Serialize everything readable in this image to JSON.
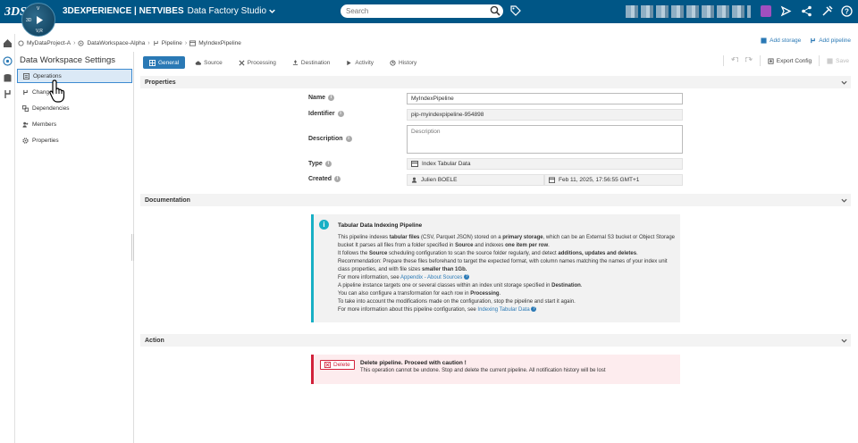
{
  "app": {
    "brand_bold": "3DEXPERIENCE | NETVIBES",
    "app_name": "Data Factory Studio",
    "logo_text": "3DS",
    "compass_labels": {
      "top": "V",
      "left": "3D",
      "bottom": "V,R"
    }
  },
  "search": {
    "placeholder": "Search"
  },
  "breadcrumb": {
    "project": "MyDataProject-A",
    "workspace": "DataWorkspace-Alpha",
    "type": "Pipeline",
    "item": "MyIndexPipeline"
  },
  "top_actions": {
    "add_storage": "Add storage",
    "add_pipeline": "Add pipeline"
  },
  "settings": {
    "title": "Data Workspace Settings",
    "items": [
      {
        "label": "Operations",
        "icon": "list-icon",
        "active": true
      },
      {
        "label": "Changes",
        "icon": "branch-icon"
      },
      {
        "label": "Dependencies",
        "icon": "link-icon"
      },
      {
        "label": "Members",
        "icon": "users-icon"
      },
      {
        "label": "Properties",
        "icon": "gear-icon"
      }
    ]
  },
  "tabs": [
    {
      "label": "General",
      "icon": "grid-icon",
      "active": true
    },
    {
      "label": "Source",
      "icon": "cloud-icon"
    },
    {
      "label": "Processing",
      "icon": "tools-icon"
    },
    {
      "label": "Destination",
      "icon": "upload-icon"
    },
    {
      "label": "Activity",
      "icon": "play-icon"
    },
    {
      "label": "History",
      "icon": "history-icon"
    }
  ],
  "toolbar": {
    "export_label": "Export Config",
    "save_label": "Save"
  },
  "properties": {
    "header": "Properties",
    "name_label": "Name",
    "name_value": "MyIndexPipeline",
    "identifier_label": "Identifier",
    "identifier_value": "pip-myindexpipeline-954898",
    "description_label": "Description",
    "description_placeholder": "Description",
    "type_label": "Type",
    "type_value": "Index Tabular Data",
    "created_label": "Created",
    "created_by": "Julien BOELE",
    "created_at": "Feb 11, 2025, 17:56:55 GMT+1"
  },
  "documentation": {
    "header": "Documentation",
    "title": "Tabular Data Indexing Pipeline",
    "p1a": "This pipeline indexes ",
    "p1b": "tabular files",
    "p1c": " (CSV, Parquet JSON) stored on a ",
    "p1d": "primary storage",
    "p1e": ", which can be an External S3 bucket or Object Storage bucket It parses all files from a folder specified in ",
    "p1f": "Source",
    "p1g": " and indexes ",
    "p1h": "one item per row",
    "p1i": ".",
    "p2a": "It follows the ",
    "p2b": "Source",
    "p2c": " scheduling configuration to scan the source folder regularly, and detect ",
    "p2d": "additions, updates and deletes",
    "p2e": ".",
    "p3a": "Recommendation: Prepare these files beforehand to target the expected format, with column names matching the names of your index unit class properties, and with file sizes ",
    "p3b": "smaller than 1Gb.",
    "p4a": "For more information, see ",
    "p4link": "Appendix - About Sources",
    "p5a": "A pipeline instance targets one or several classes within an index unit storage specified in ",
    "p5b": "Destination",
    "p5c": ".",
    "p6a": "You can also configure a transformation for each row in ",
    "p6b": "Processing",
    "p6c": ".",
    "p7": "To take into account the modifications made on the configuration, stop the pipeline and start it again.",
    "p8a": "For more information about this pipeline configuration, see ",
    "p8link": "Indexing Tabular Data"
  },
  "action": {
    "header": "Action",
    "delete_label": "Delete",
    "danger_title": "Delete pipeline. Proceed with caution !",
    "danger_text": "This operation cannot be undone. Stop and delete the current pipeline. All notification history will be lost"
  },
  "colors": {
    "topbar": "#005686",
    "accent": "#2a79b5",
    "info": "#18b0c5",
    "danger": "#d2223b"
  }
}
